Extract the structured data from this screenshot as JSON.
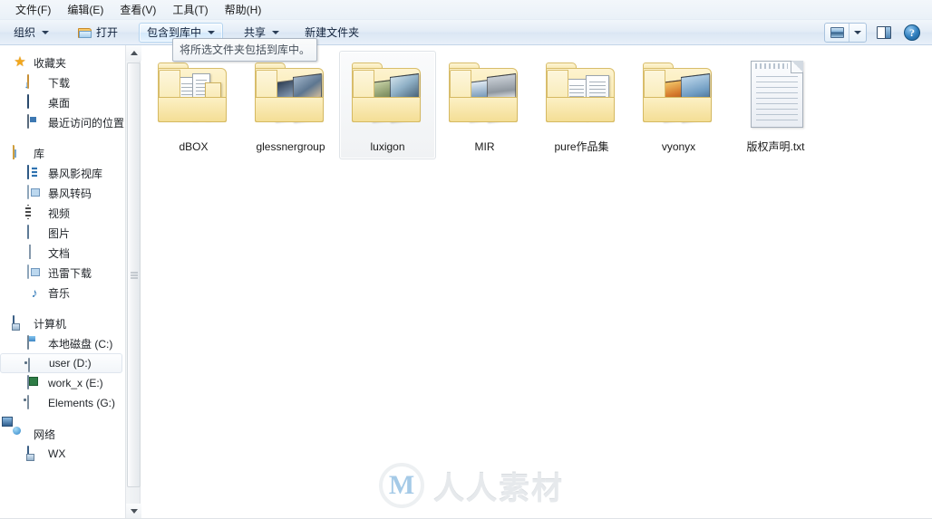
{
  "menubar": {
    "items": [
      {
        "label": "文件(F)",
        "name": "menu-file"
      },
      {
        "label": "编辑(E)",
        "name": "menu-edit"
      },
      {
        "label": "查看(V)",
        "name": "menu-view"
      },
      {
        "label": "工具(T)",
        "name": "menu-tools"
      },
      {
        "label": "帮助(H)",
        "name": "menu-help"
      }
    ]
  },
  "toolbar": {
    "organize_label": "组织",
    "open_label": "打开",
    "include_in_library_label": "包含到库中",
    "share_label": "共享",
    "new_folder_label": "新建文件夹",
    "view_icon": "picture-view-icon",
    "view_dropdown_icon": "chevron-down-icon",
    "preview_pane_icon": "preview-pane-icon",
    "help_icon": "help-icon",
    "help_glyph": "?"
  },
  "tooltip": {
    "text": "将所选文件夹包括到库中。"
  },
  "sidebar": {
    "sections": [
      {
        "name": "favorites",
        "header": {
          "label": "收藏夹",
          "icon": "star-icon"
        },
        "items": [
          {
            "label": "下载",
            "icon": "downloads-icon",
            "selected": false
          },
          {
            "label": "桌面",
            "icon": "desktop-icon",
            "selected": false
          },
          {
            "label": "最近访问的位置",
            "icon": "recent-places-icon",
            "selected": false
          }
        ]
      },
      {
        "name": "libraries",
        "header": {
          "label": "库",
          "icon": "library-folder-icon"
        },
        "items": [
          {
            "label": "暴风影视库",
            "icon": "video-library-icon",
            "selected": false
          },
          {
            "label": "暴风转码",
            "icon": "transcode-icon",
            "selected": false
          },
          {
            "label": "视频",
            "icon": "film-icon",
            "selected": false
          },
          {
            "label": "图片",
            "icon": "pictures-icon",
            "selected": false
          },
          {
            "label": "文档",
            "icon": "documents-icon",
            "selected": false
          },
          {
            "label": "迅雷下载",
            "icon": "thunder-download-icon",
            "selected": false
          },
          {
            "label": "音乐",
            "icon": "music-note-icon",
            "selected": false
          }
        ]
      },
      {
        "name": "computer",
        "header": {
          "label": "计算机",
          "icon": "computer-icon"
        },
        "items": [
          {
            "label": "本地磁盘 (C:)",
            "icon": "system-drive-icon",
            "selected": false
          },
          {
            "label": "user (D:)",
            "icon": "drive-icon",
            "selected": true
          },
          {
            "label": "work_x (E:)",
            "icon": "drive-green-icon",
            "selected": false
          },
          {
            "label": "Elements (G:)",
            "icon": "drive-icon",
            "selected": false
          }
        ]
      },
      {
        "name": "network",
        "header": {
          "label": "网络",
          "icon": "network-icon"
        },
        "items": [
          {
            "label": "WX",
            "icon": "computer-node-icon",
            "selected": false
          }
        ]
      }
    ],
    "scrollbar": {
      "up_icon": "scroll-up-arrow-icon",
      "down_icon": "scroll-down-arrow-icon"
    }
  },
  "content": {
    "items": [
      {
        "label": "dBOX",
        "kind": "folder",
        "preview": "documents",
        "selected": false
      },
      {
        "label": "glessnergroup",
        "kind": "folder",
        "preview": "photos",
        "selected": false
      },
      {
        "label": "luxigon",
        "kind": "folder",
        "preview": "photos",
        "selected": true
      },
      {
        "label": "MIR",
        "kind": "folder",
        "preview": "photos",
        "selected": false
      },
      {
        "label": "pure作品集",
        "kind": "folder",
        "preview": "documents",
        "selected": false
      },
      {
        "label": "vyonyx",
        "kind": "folder",
        "preview": "photos",
        "selected": false
      },
      {
        "label": "版权声明.txt",
        "kind": "textfile",
        "preview": "none",
        "selected": false
      }
    ]
  },
  "watermark": {
    "logo_letter": "M",
    "text": "人人素材"
  },
  "colors": {
    "accent": "#2f7ebd",
    "folder": "#f8e49b",
    "toolbar_bg": "#e3ecf6",
    "selection": "#f0f2f4"
  }
}
